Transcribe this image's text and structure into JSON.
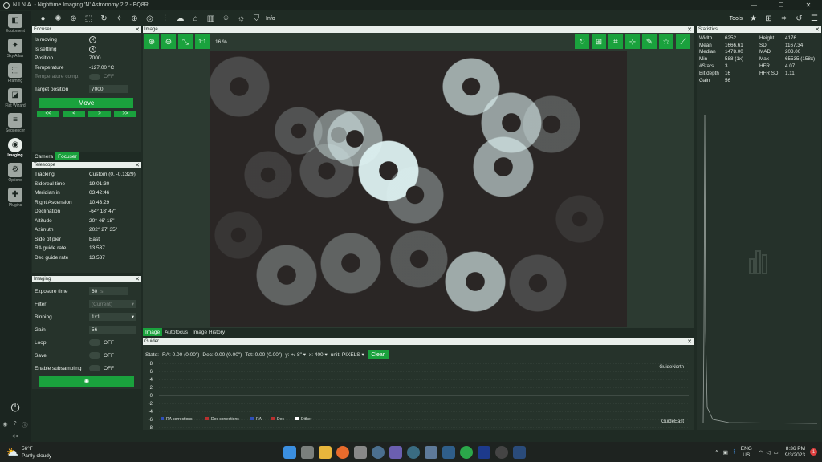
{
  "window": {
    "title": "N.I.N.A. - Nighttime Imaging 'N' Astronomy 2.2 - EQ8R",
    "min": "—",
    "max": "☐",
    "close": "✕"
  },
  "toolbar": {
    "info_label": "Info",
    "tools_label": "Tools"
  },
  "nav": [
    {
      "label": "Equipment",
      "icon": "camera-gear-icon"
    },
    {
      "label": "Sky Atlas",
      "icon": "sky-atlas-icon"
    },
    {
      "label": "Framing",
      "icon": "framing-icon"
    },
    {
      "label": "Flat Wizard",
      "icon": "flat-wizard-icon"
    },
    {
      "label": "Sequencer",
      "icon": "sequencer-icon"
    },
    {
      "label": "Imaging",
      "icon": "imaging-icon"
    },
    {
      "label": "Options",
      "icon": "gear-icon"
    },
    {
      "label": "Plugins",
      "icon": "puzzle-icon"
    }
  ],
  "focuser": {
    "title": "Focuser",
    "is_moving": "Is moving",
    "is_settling": "Is settling",
    "position_label": "Position",
    "position": "7000",
    "temperature_label": "Temperature",
    "temperature": "-127.00 °C",
    "temp_comp_label": "Temperature comp.",
    "temp_comp": "OFF",
    "target_label": "Target position",
    "target": "7000",
    "move": "Move",
    "step_ll": "<<",
    "step_l": "<",
    "step_r": ">",
    "step_rr": ">>"
  },
  "tabs1": {
    "camera": "Camera",
    "focuser": "Focuser"
  },
  "telescope": {
    "title": "Telescope",
    "rows": [
      [
        "Tracking",
        "Custom (0, -0.1329)"
      ],
      [
        "Sidereal time",
        "19:01:30"
      ],
      [
        "Meridian in",
        "03:42:46"
      ],
      [
        "Right Ascension",
        "10:43:29"
      ],
      [
        "Declination",
        "-64° 18' 47\""
      ],
      [
        "Altitude",
        "20° 46' 18\""
      ],
      [
        "Azimuth",
        "202° 27' 35\""
      ],
      [
        "Side of pier",
        "East"
      ],
      [
        "RA guide rate",
        "13.537"
      ],
      [
        "Dec guide rate",
        "13.537"
      ]
    ]
  },
  "imaging": {
    "title": "Imaging",
    "exposure_label": "Exposure time",
    "exposure": "60",
    "exposure_unit": "s",
    "filter_label": "Filter",
    "filter": "(Current)",
    "binning_label": "Binning",
    "binning": "1x1",
    "gain_label": "Gain",
    "gain": "56",
    "loop_label": "Loop",
    "loop": "OFF",
    "save_label": "Save",
    "save": "OFF",
    "subsampling_label": "Enable subsampling",
    "subsampling": "OFF"
  },
  "image": {
    "title": "Image",
    "zoom_11": "1:1",
    "zoom": "16 %",
    "tab_image": "Image",
    "tab_autofocus": "Autofocus",
    "tab_history": "Image History"
  },
  "stats": {
    "title": "Statistics",
    "rows": [
      [
        "Width",
        "6252",
        "Height",
        "4176"
      ],
      [
        "Mean",
        "1666.61",
        "SD",
        "1167.34"
      ],
      [
        "Median",
        "1478.00",
        "MAD",
        "203.00"
      ],
      [
        "Min",
        "588 (1x)",
        "Max",
        "65535 (158x)"
      ],
      [
        "#Stars",
        "3",
        "HFR",
        "4.07"
      ],
      [
        "Bit depth",
        "16",
        "HFR SD",
        "1.11"
      ],
      [
        "Gain",
        "56",
        "",
        ""
      ]
    ]
  },
  "guider": {
    "title": "Guider",
    "state": "State:",
    "ra": "RA: 0.00 (0.00\")",
    "dec": "Dec: 0.00 (0.00\")",
    "tot": "Tot: 0.00 (0.00\")",
    "y_scale": "y: +/-8\"",
    "x_range": "x: 400",
    "unit": "unit: PIXELS",
    "clear": "Clear",
    "north": "GuideNorth",
    "east": "GuideEast",
    "yticks": [
      "8",
      "6",
      "4",
      "2",
      "0",
      "-2",
      "-4",
      "-6",
      "-8"
    ],
    "legend": [
      "RA corrections",
      "Dec corrections",
      "RA",
      "Dec",
      "Dither"
    ]
  },
  "taskbar": {
    "temp": "56°F",
    "weather": "Partly cloudy",
    "lang": "ENG",
    "region": "US",
    "time": "8:36 PM",
    "date": "9/3/2023",
    "badge": "1"
  },
  "colors": {
    "accent": "#1aa23d",
    "bg": "#1f2b24",
    "panel_header": "#e9efeb"
  }
}
